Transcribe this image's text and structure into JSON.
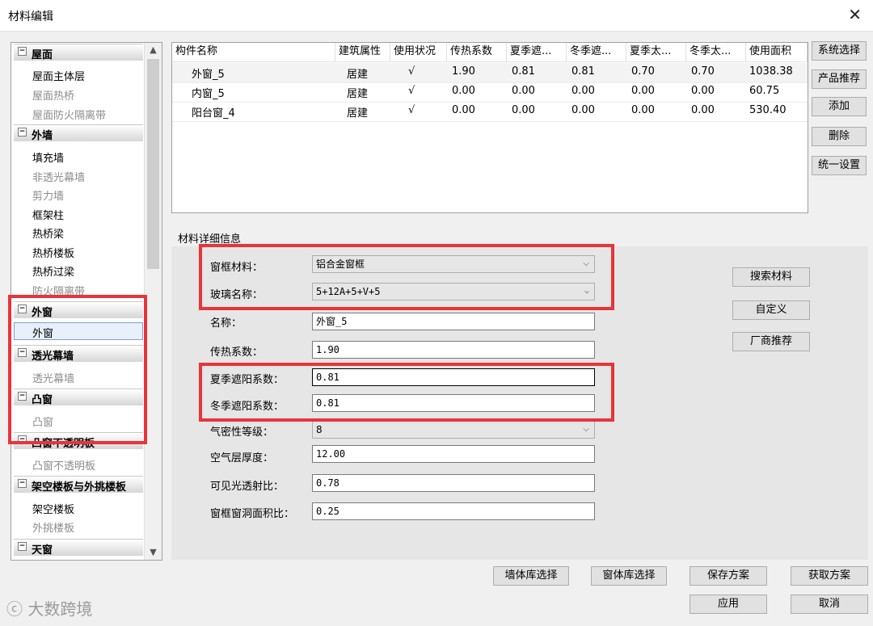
{
  "window": {
    "title": "材料编辑",
    "close": "✕"
  },
  "sidebar": {
    "groups": [
      {
        "label": "屋面",
        "items": [
          "屋面主体层",
          "屋面热桥",
          "屋面防火隔离带"
        ]
      },
      {
        "label": "外墙",
        "items": [
          "填充墙",
          "非透光幕墙",
          "剪力墙",
          "框架柱",
          "热桥梁",
          "热桥楼板",
          "热桥过梁",
          "防火隔离带"
        ]
      },
      {
        "label": "外窗",
        "items": [
          "外窗"
        ]
      },
      {
        "label": "透光幕墙",
        "items": [
          "透光幕墙"
        ]
      },
      {
        "label": "凸窗",
        "items": [
          "凸窗"
        ]
      },
      {
        "label": "凸窗不透明板",
        "items": [
          "凸窗不透明板"
        ]
      },
      {
        "label": "架空楼板与外挑楼板",
        "items": [
          "架空楼板",
          "外挑楼板"
        ]
      },
      {
        "label": "天窗",
        "items": []
      }
    ],
    "scroll_up": "▲",
    "scroll_down": "▼"
  },
  "table": {
    "headers": [
      "构件名称",
      "建筑属性",
      "使用状况",
      "传热系数",
      "夏季遮...",
      "冬季遮...",
      "夏季太...",
      "冬季太...",
      "使用面积"
    ],
    "rows": [
      [
        "外窗_5",
        "居建",
        "√",
        "1.90",
        "0.81",
        "0.81",
        "0.70",
        "0.70",
        "1038.38"
      ],
      [
        "内窗_5",
        "居建",
        "√",
        "0.00",
        "0.00",
        "0.00",
        "0.00",
        "0.00",
        "60.75"
      ],
      [
        "阳台窗_4",
        "居建",
        "√",
        "0.00",
        "0.00",
        "0.00",
        "0.00",
        "0.00",
        "530.40"
      ]
    ]
  },
  "right_buttons": [
    "系统选择",
    "产品推荐",
    "添加",
    "删除",
    "统一设置"
  ],
  "details": {
    "title": "材料详细信息",
    "frame_material_label": "窗框材料：",
    "frame_material_value": "铝合金窗框",
    "glass_label": "玻璃名称：",
    "glass_value": "5+12A+5+V+5",
    "name_label": "名称：",
    "name_value": "外窗_5",
    "u_label": "传热系数：",
    "u_value": "1.90",
    "summer_label": "夏季遮阳系数：",
    "summer_value": "0.81",
    "winter_label": "冬季遮阳系数：",
    "winter_value": "0.81",
    "airtight_label": "气密性等级：",
    "airtight_value": "8",
    "air_label": "空气层厚度：",
    "air_value": "12.00",
    "visible_label": "可见光透射比：",
    "visible_value": "0.78",
    "ratio_label": "窗框窗洞面积比：",
    "ratio_value": "0.25",
    "search_btn": "搜索材料",
    "custom_btn": "自定义",
    "vendor_btn": "厂商推荐"
  },
  "bottom_buttons": {
    "wall_lib": "墙体库选择",
    "window_lib": "窗体库选择",
    "save": "保存方案",
    "get": "获取方案",
    "apply": "应用",
    "cancel": "取消"
  },
  "watermark": "大数跨境",
  "colors": {
    "highlight": "#e8343a",
    "panel": "#e6e6e6"
  }
}
